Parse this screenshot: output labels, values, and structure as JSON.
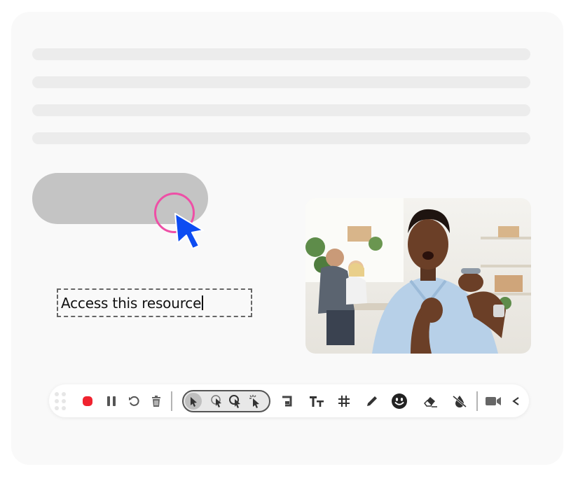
{
  "textbox": {
    "value": "Access this resource"
  },
  "colors": {
    "accent_pink": "#ee4fa6",
    "cursor_blue": "#0d4cf2",
    "record_red": "#f0232f",
    "button_grey": "#c4c4c4"
  },
  "video": {
    "description_icon": "video-feed"
  },
  "toolbar": {
    "items": [
      "drag-handle-icon",
      "record-icon",
      "pause-icon",
      "undo-icon",
      "trash-icon",
      "pointer-icon",
      "click-pointer-icon",
      "zoom-pointer-icon",
      "spark-pointer-icon",
      "crop-icon",
      "text-size-icon",
      "grid-icon",
      "pencil-icon",
      "emoji-icon",
      "eraser-icon",
      "ink-drop-icon",
      "camera-icon",
      "collapse-icon"
    ]
  }
}
